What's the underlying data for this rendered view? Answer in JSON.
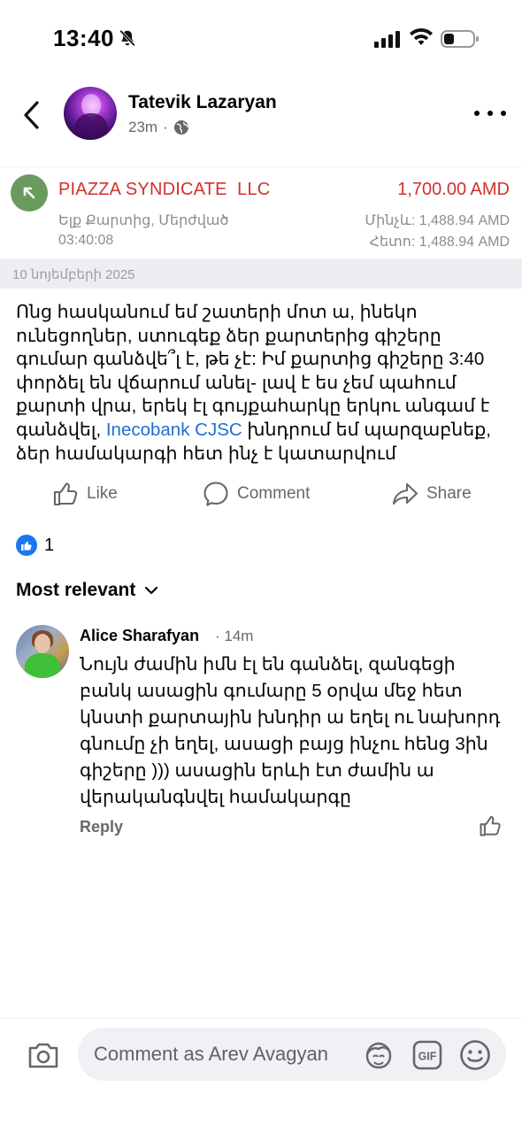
{
  "status_bar": {
    "time": "13:40",
    "icons": [
      "bell-off-icon",
      "signal-icon",
      "wifi-icon",
      "battery-icon"
    ]
  },
  "header": {
    "author": "Tatevik Lazaryan",
    "time_ago": "23m",
    "separator": "·",
    "icons": [
      "back-chevron-icon",
      "globe-icon",
      "more-dots-icon"
    ]
  },
  "transaction": {
    "merchant": "PIAZZA SYNDICATE  LLC",
    "amount": "1,700.00 AMD",
    "description": "Ելք Քարտից, Մերժված",
    "time": "03:40:08",
    "balance_before": "Մինչև: 1,488.94 AMD",
    "balance_after": "Հետո: 1,488.94 AMD",
    "date": "10 նոյեմբերի 2025",
    "icon": "outgoing-arrow-icon",
    "colors": {
      "amount": "#d0312d",
      "icon_bg": "#6b9a5e"
    }
  },
  "post": {
    "text_before_link": "Ոնց հասկանում եմ շատերի մոտ ա, ինեկո ունեցողներ, ստուգեք ձեր քարտերից գիշերը գումար գանձվե՞լ է, թե չէ: Իմ քարտից գիշերը 3:40 փորձել են վճարում անել- լավ է ես չեմ պահում քարտի վրա, երեկ էլ գույքահարկը երկու անգամ է գանձվել, ",
    "link": "Inecobank CJSC",
    "text_after_link": " խնդրում եմ պարզաբնեք, ձեր համակարգի հետ ինչ է կատարվում"
  },
  "actions": {
    "like": "Like",
    "comment": "Comment",
    "share": "Share"
  },
  "reactions": {
    "count": "1",
    "icon": "like-reaction-icon",
    "color": "#1877f2"
  },
  "sort": {
    "label": "Most relevant",
    "icon": "chevron-down-icon"
  },
  "comment": {
    "author": "Alice Sharafyan",
    "time": "· 14m",
    "text": "Նույն ժամին իմն էլ են գանձել, զանգեցի բանկ ասացին գումարը 5 օրվա մեջ հետ կնստի քարտային խնդիր ա եղել ու նախորդ գնումը չի եղել, ասացի բայց ինչու հենց 3ին գիշերը ))) ասացին երևի էտ ժամին ա վերականգնվել համակարգը",
    "reply": "Reply"
  },
  "composer": {
    "placeholder": "Comment as Arev Avagyan",
    "icons": [
      "camera-icon",
      "avatar-sticker-icon",
      "gif-icon",
      "emoji-icon"
    ]
  }
}
